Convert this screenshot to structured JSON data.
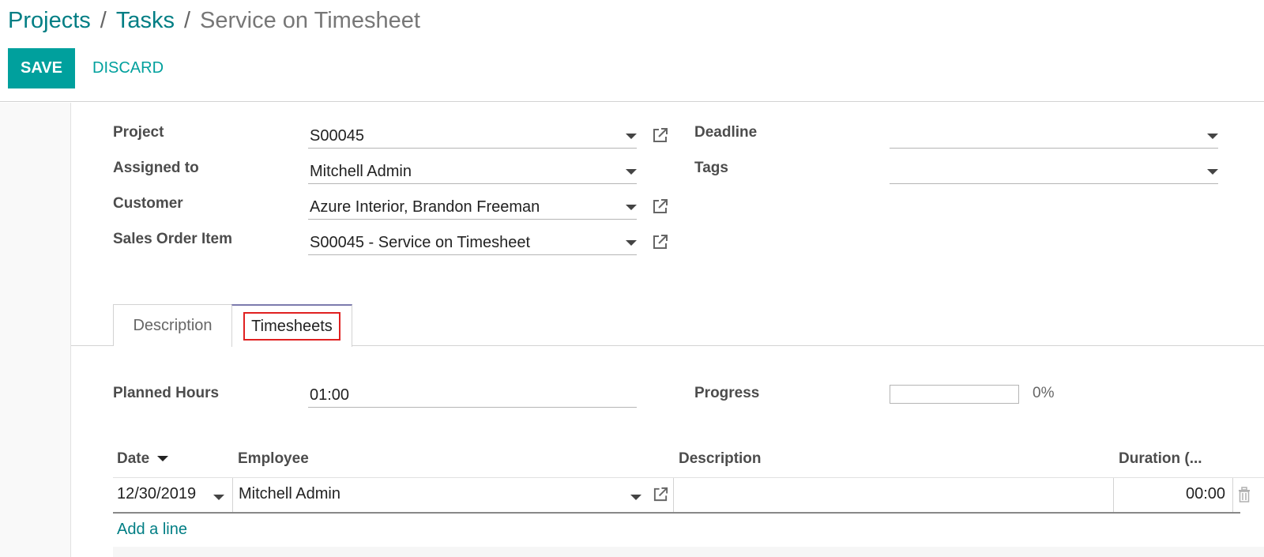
{
  "breadcrumb": {
    "items": [
      "Projects",
      "Tasks"
    ],
    "separator": "/",
    "current": "Service on Timesheet"
  },
  "buttons": {
    "save_label": "SAVE",
    "discard_label": "DISCARD"
  },
  "form": {
    "project": {
      "label": "Project",
      "value": "S00045"
    },
    "assigned_to": {
      "label": "Assigned to",
      "value": "Mitchell Admin"
    },
    "customer": {
      "label": "Customer",
      "value": "Azure Interior, Brandon Freeman"
    },
    "sales_order_item": {
      "label": "Sales Order Item",
      "value": "S00045 - Service on Timesheet"
    },
    "deadline": {
      "label": "Deadline",
      "value": ""
    },
    "tags": {
      "label": "Tags",
      "value": ""
    }
  },
  "tabs": [
    {
      "label": "Description",
      "active": false
    },
    {
      "label": "Timesheets",
      "active": true
    }
  ],
  "timesheets": {
    "planned_hours": {
      "label": "Planned Hours",
      "value": "01:00"
    },
    "progress": {
      "label": "Progress",
      "value": 0,
      "text": "0%"
    },
    "columns": [
      "Date",
      "Employee",
      "Description",
      "Duration (..."
    ],
    "rows": [
      {
        "date": "12/30/2019",
        "employee": "Mitchell Admin",
        "description": "",
        "duration": "00:00"
      }
    ],
    "add_line_label": "Add a line"
  },
  "colors": {
    "primary": "#00a09d",
    "link": "#017e84",
    "highlight_box": "#e02020"
  },
  "icons": [
    "external-link-icon",
    "caret-down-icon",
    "trash-icon",
    "sort-down-icon"
  ]
}
